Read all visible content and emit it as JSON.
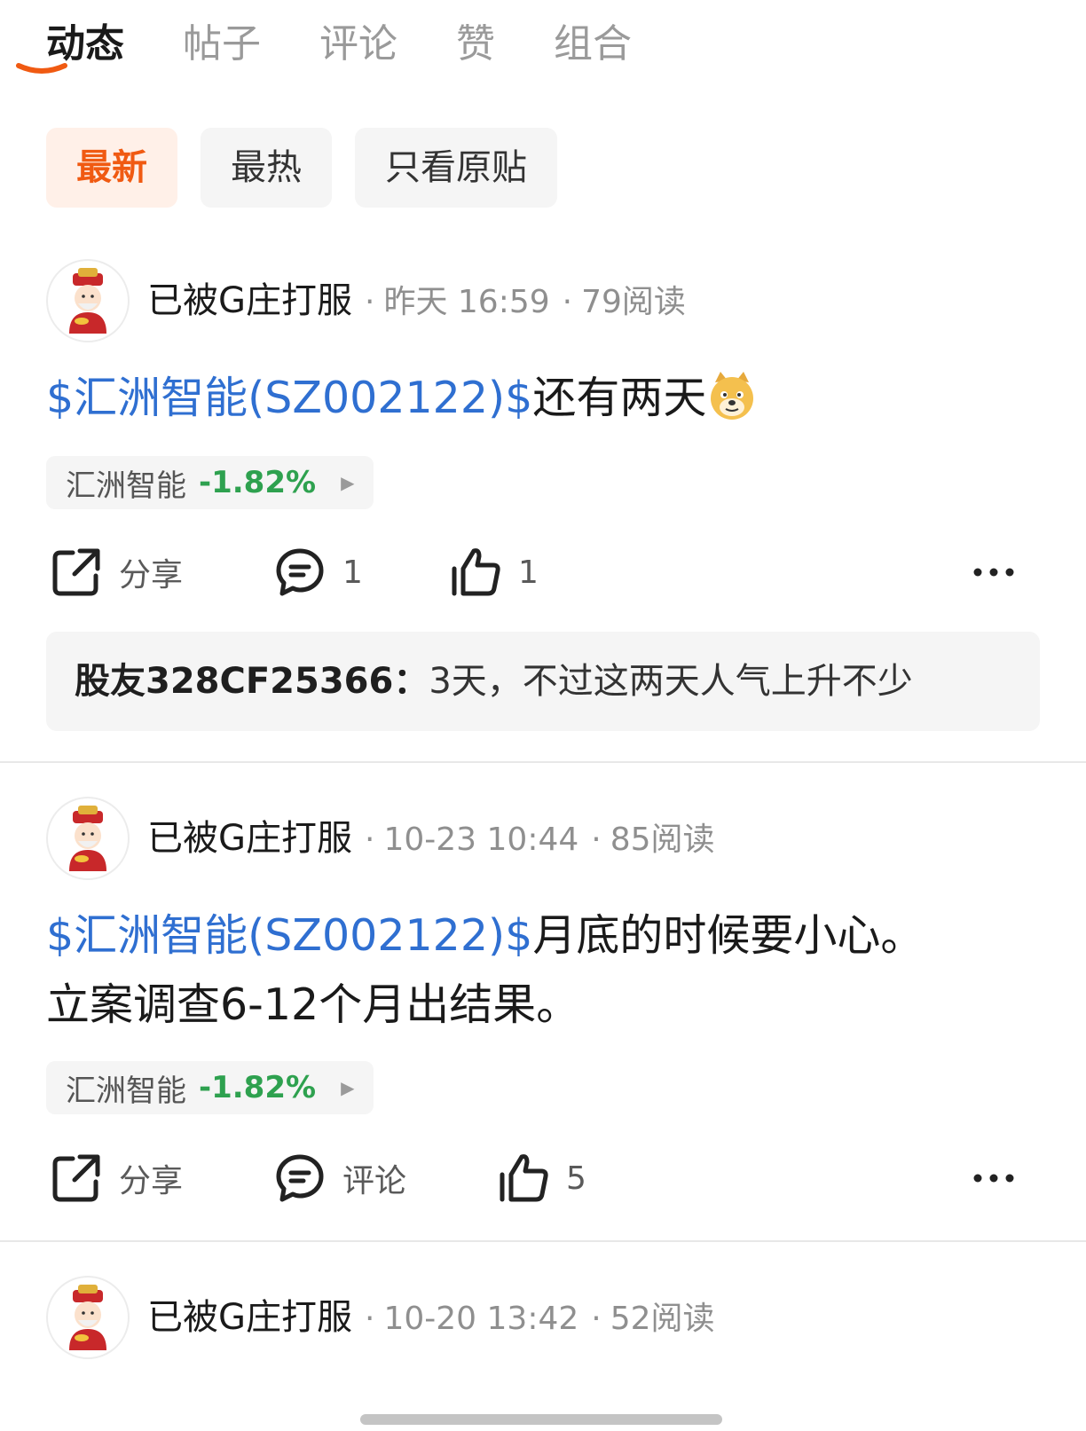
{
  "tabs": [
    "动态",
    "帖子",
    "评论",
    "赞",
    "组合"
  ],
  "filters": [
    "最新",
    "最热",
    "只看原贴"
  ],
  "colors": {
    "accent": "#f05a12",
    "link": "#2f6fd1",
    "down": "#2ea14f"
  },
  "posts": [
    {
      "user": "已被G庄打服",
      "time": "昨天 16:59",
      "reads": "79阅读",
      "stock_link": "$汇洲智能(SZ002122)$",
      "text": "还有两天",
      "emoji": "doge-emoji",
      "quote": {
        "name": "汇洲智能",
        "change": "-1.82%"
      },
      "share_label": "分享",
      "comment_label": "1",
      "like_label": "1",
      "comment": {
        "user": "股友328CF25366：",
        "text": "3天，不过这两天人气上升不少"
      }
    },
    {
      "user": "已被G庄打服",
      "time": "10-23 10:44",
      "reads": "85阅读",
      "stock_link": "$汇洲智能(SZ002122)$",
      "text": "月底的时候要小心。",
      "text2": "立案调查6-12个月出结果。",
      "quote": {
        "name": "汇洲智能",
        "change": "-1.82%"
      },
      "share_label": "分享",
      "comment_label": "评论",
      "like_label": "5"
    },
    {
      "user": "已被G庄打服",
      "time": "10-20 13:42",
      "reads": "52阅读"
    }
  ]
}
